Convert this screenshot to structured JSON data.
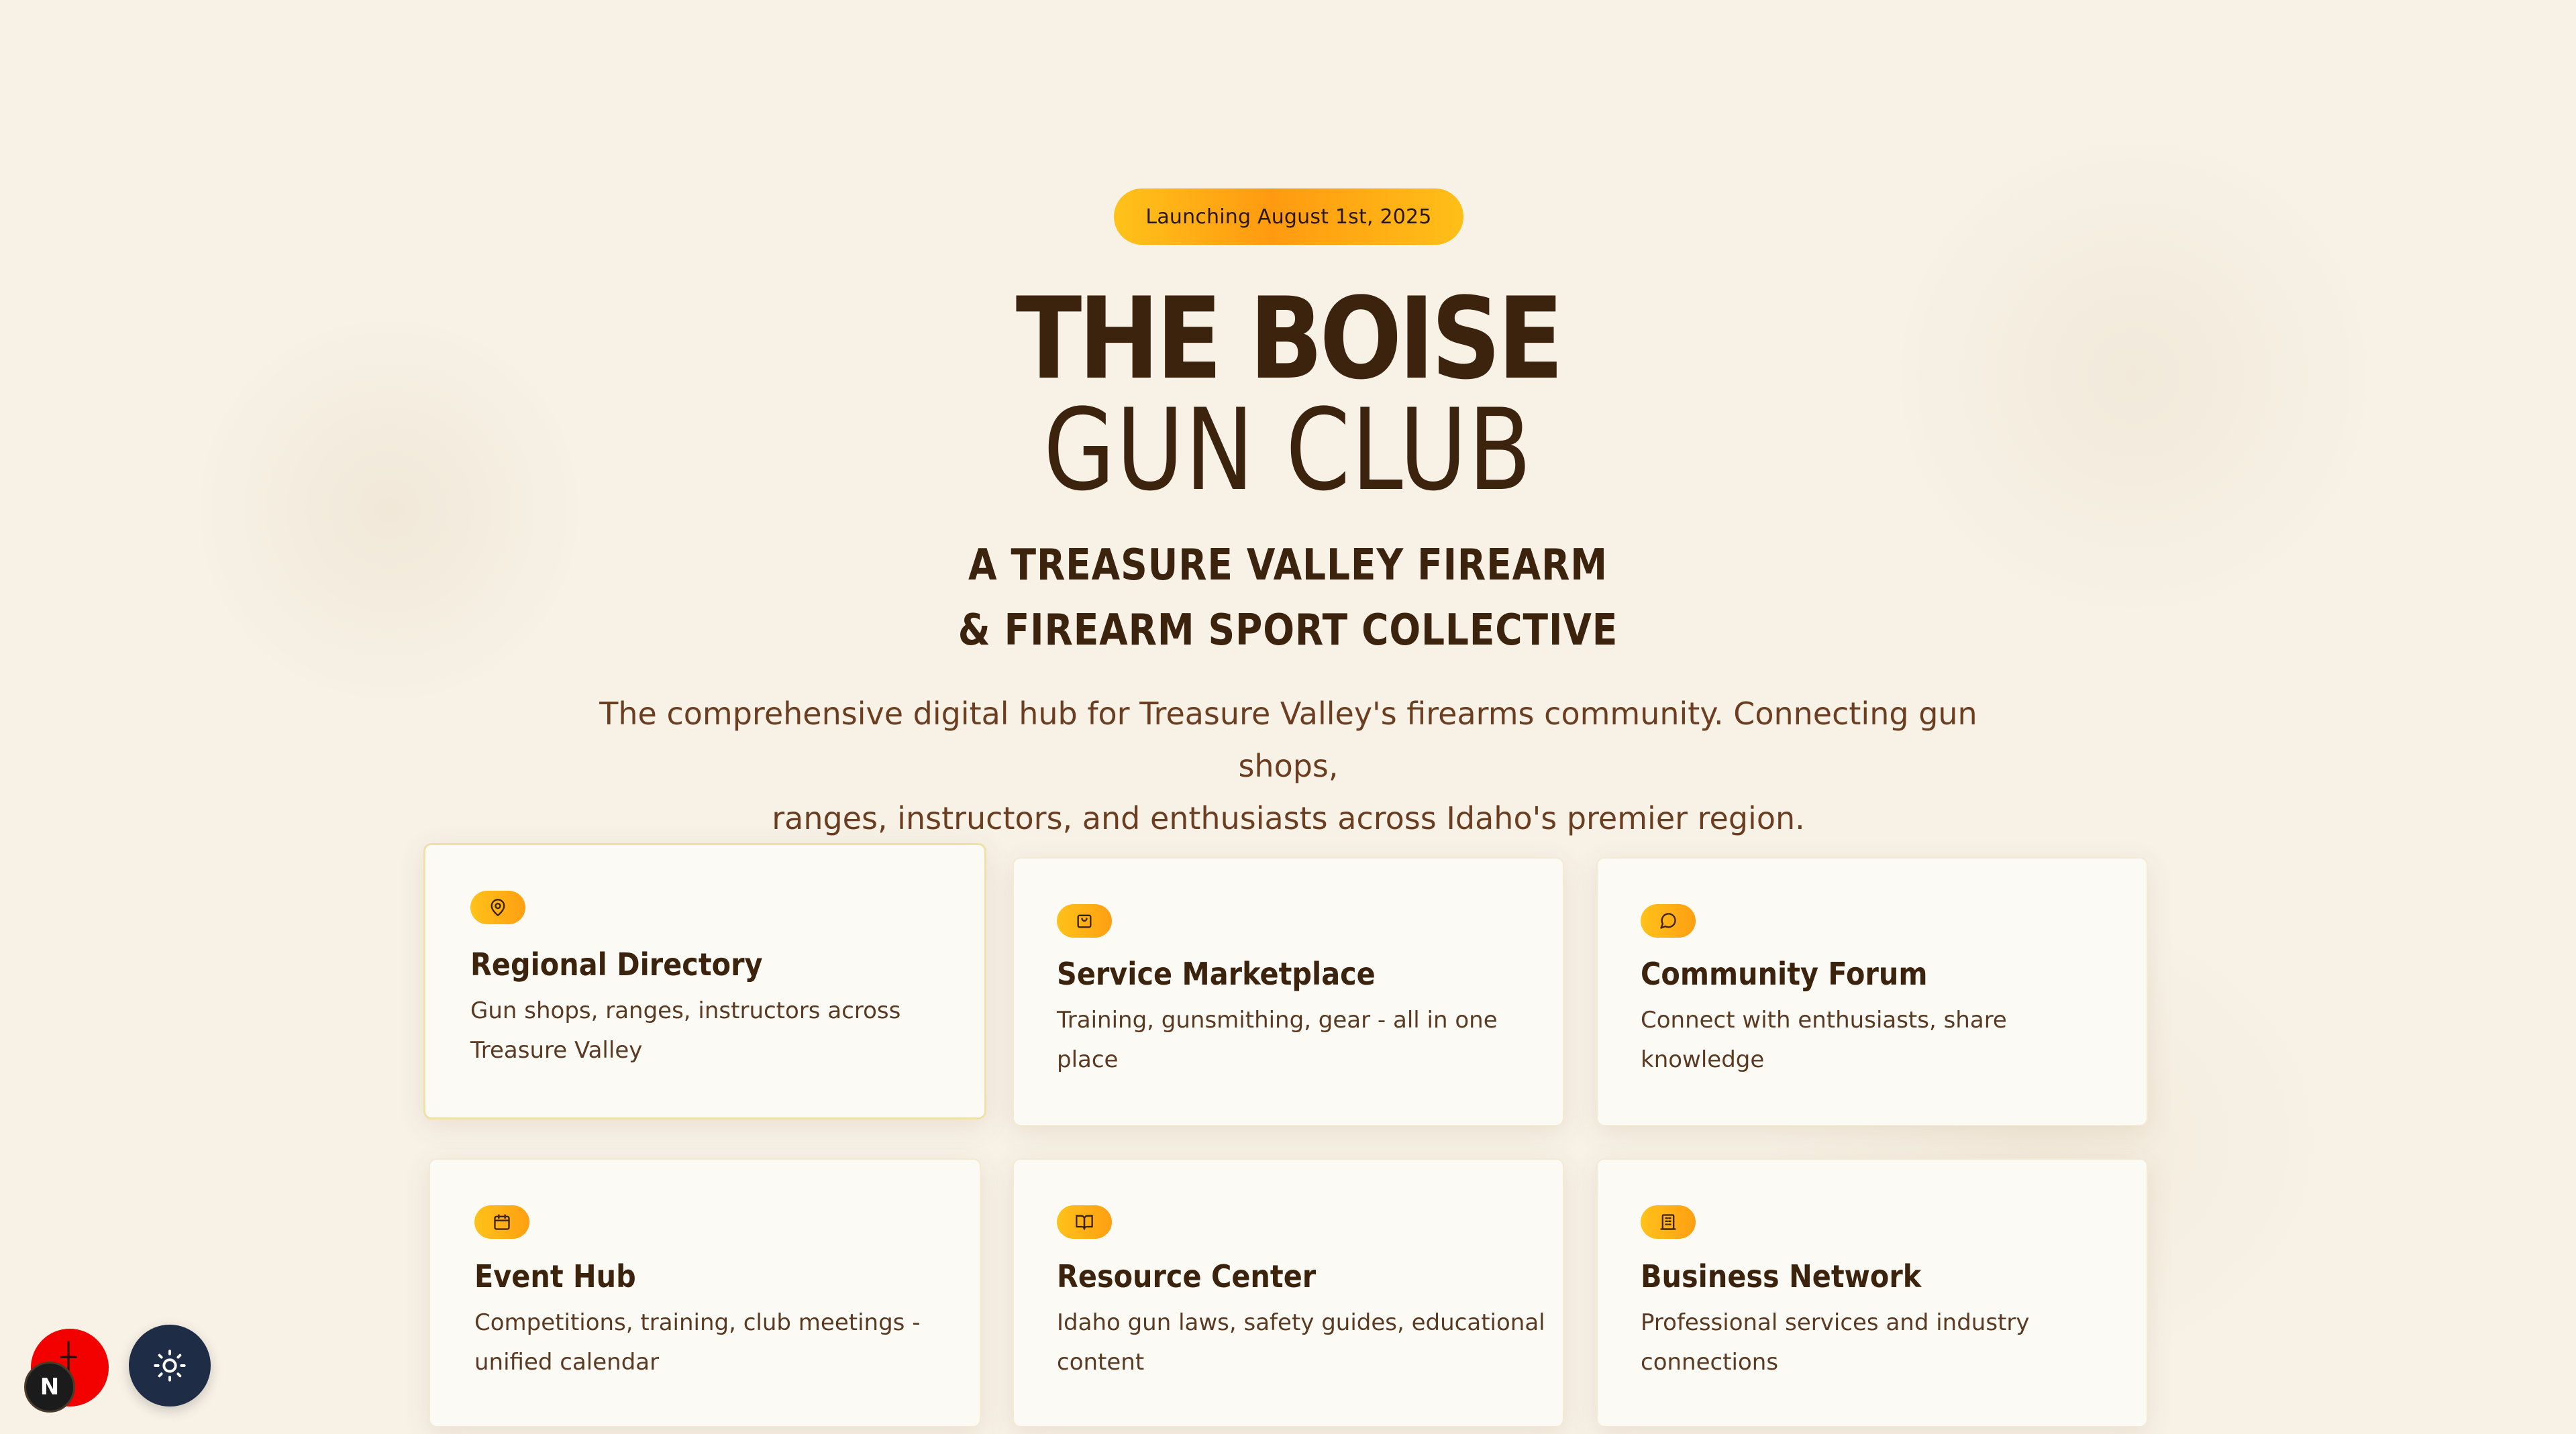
{
  "hero": {
    "badge": "Launching August 1st, 2025",
    "title_line1": "THE BOISE",
    "title_line2": "GUN CLUB",
    "subtitle_line1": "A TREASURE VALLEY FIREARM",
    "subtitle_line2": "& FIREARM SPORT COLLECTIVE",
    "description_line1": "The comprehensive digital hub for Treasure Valley's firearms community. Connecting gun shops,",
    "description_line2": "ranges, instructors, and enthusiasts across Idaho's premier region."
  },
  "features": [
    {
      "icon": "map-pin-icon",
      "title": "Regional Directory",
      "desc_line1": "Gun shops, ranges, instructors across",
      "desc_line2": "Treasure Valley"
    },
    {
      "icon": "shopping-bag-icon",
      "title": "Service Marketplace",
      "desc_line1": "Training, gunsmithing, gear - all in one place",
      "desc_line2": ""
    },
    {
      "icon": "message-circle-icon",
      "title": "Community Forum",
      "desc_line1": "Connect with enthusiasts, share knowledge",
      "desc_line2": ""
    },
    {
      "icon": "calendar-icon",
      "title": "Event Hub",
      "desc_line1": "Competitions, training, club meetings -",
      "desc_line2": "unified calendar"
    },
    {
      "icon": "book-open-icon",
      "title": "Resource Center",
      "desc_line1": "Idaho gun laws, safety guides, educational",
      "desc_line2": "content"
    },
    {
      "icon": "building-icon",
      "title": "Business Network",
      "desc_line1": "Professional services and industry",
      "desc_line2": "connections"
    }
  ],
  "floating": {
    "dev_indicator_letter": "N",
    "theme_toggle_icon": "sun-icon"
  },
  "colors": {
    "background": "#f7f1e6",
    "text_dark": "#3c230e",
    "text_muted": "#6b3e22",
    "accent_start": "#ffc21a",
    "accent_mid": "#ff9a10",
    "card_bg": "#fcfaf4",
    "theme_button": "#1e2c45",
    "red_button": "#f30000"
  }
}
